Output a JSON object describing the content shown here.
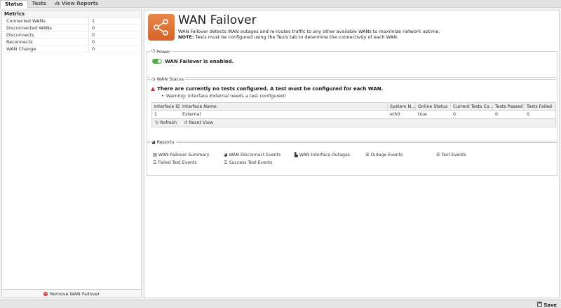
{
  "tabs": [
    {
      "label": "Status"
    },
    {
      "label": "Tests"
    },
    {
      "label": "View Reports"
    }
  ],
  "metrics": {
    "title": "Metrics",
    "rows": [
      {
        "key": "Connected WANs",
        "value": "1"
      },
      {
        "key": "Disconnected WANs",
        "value": "0"
      },
      {
        "key": "Disconnects",
        "value": "0"
      },
      {
        "key": "Reconnects",
        "value": "0"
      },
      {
        "key": "WAN Change",
        "value": "0"
      }
    ],
    "remove_label": "Remove WAN Failover"
  },
  "app": {
    "title": "WAN Failover",
    "description": "WAN Failover detects WAN outages and re-routes traffic to any other available WANs to maximize network uptime.",
    "note_label": "NOTE:",
    "note_pre": " Tests must be configured using the ",
    "note_tab": "Tests",
    "note_post": " tab to determine the connectivity of each WAN."
  },
  "power": {
    "legend": "Power",
    "status": "WAN Failover is enabled.",
    "enabled": true,
    "toggle_color": "#55a84b"
  },
  "wan_status": {
    "legend": "WAN Status",
    "warning": "There are currently no tests configured. A test must be configured for each WAN.",
    "bullet_pre": "Warning: Interface ",
    "bullet_iface": "External",
    "bullet_post": " needs a test configured!",
    "columns": [
      "Interface ID",
      "Interface Name",
      "System N...",
      "Online Status",
      "Current Tests Co...",
      "Tests Passed",
      "Tests Failed"
    ],
    "rows": [
      [
        "1",
        "External",
        "eth0",
        "true",
        "0",
        "0",
        "0"
      ]
    ],
    "refresh_label": "Refresh",
    "reset_label": "Reset View"
  },
  "reports": {
    "legend": "Reports",
    "items": [
      "WAN Failover Summary",
      "WAN Disconnect Events",
      "WAN Interface Outages",
      "Outage Events",
      "Test Events",
      "Failed Test Events",
      "Success Test Events"
    ]
  },
  "save_label": "Save",
  "colors": {
    "warning_red": "#d83232",
    "accent_orange": "#d5632a"
  }
}
